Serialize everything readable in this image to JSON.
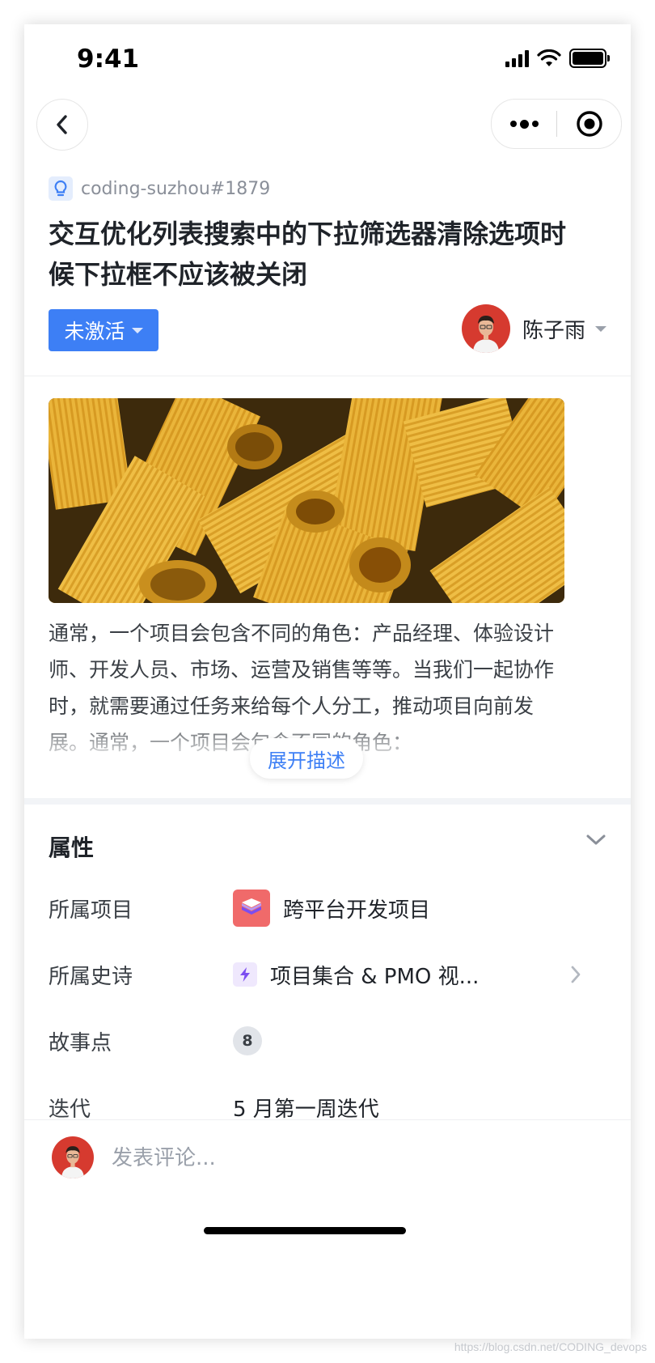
{
  "status_bar": {
    "time": "9:41"
  },
  "issue": {
    "ref": "coding-suzhou#1879",
    "title": "交互优化列表搜索中的下拉筛选器清除选项时候下拉框不应该被关闭",
    "status_label": "未激活",
    "assignee_name": "陈子雨"
  },
  "description": {
    "text": "通常，一个项目会包含不同的角色：产品经理、体验设计师、开发人员、市场、运营及销售等等。当我们一起协作时，就需要通过任务来给每个人分工，推动项目向前发展。通常，一个项目会包含不同的角色：",
    "expand_label": "展开描述"
  },
  "properties": {
    "title": "属性",
    "items": [
      {
        "label": "所属项目",
        "value": "跨平台开发项目"
      },
      {
        "label": "所属史诗",
        "value": "项目集合 & PMO 视..."
      },
      {
        "label": "故事点",
        "value": "8"
      },
      {
        "label": "迭代",
        "value": "5 月第一周迭代"
      }
    ]
  },
  "comment": {
    "placeholder": "发表评论..."
  },
  "watermark": "https://blog.csdn.net/CODING_devops",
  "colors": {
    "accent": "#3d7ff5",
    "project_icon": "#f06a6a",
    "epic_icon": "#7b4df0",
    "text_primary": "#1f2329",
    "text_secondary": "#8a8f99"
  },
  "icons": {
    "back": "chevron-left-icon",
    "more": "more-dots-icon",
    "close_miniprogram": "target-circle-icon",
    "issue_type": "lightbulb-icon",
    "project": "stack-layers-icon",
    "epic": "lightning-icon",
    "collapse": "chevron-down-icon",
    "navigate": "chevron-right-icon"
  }
}
